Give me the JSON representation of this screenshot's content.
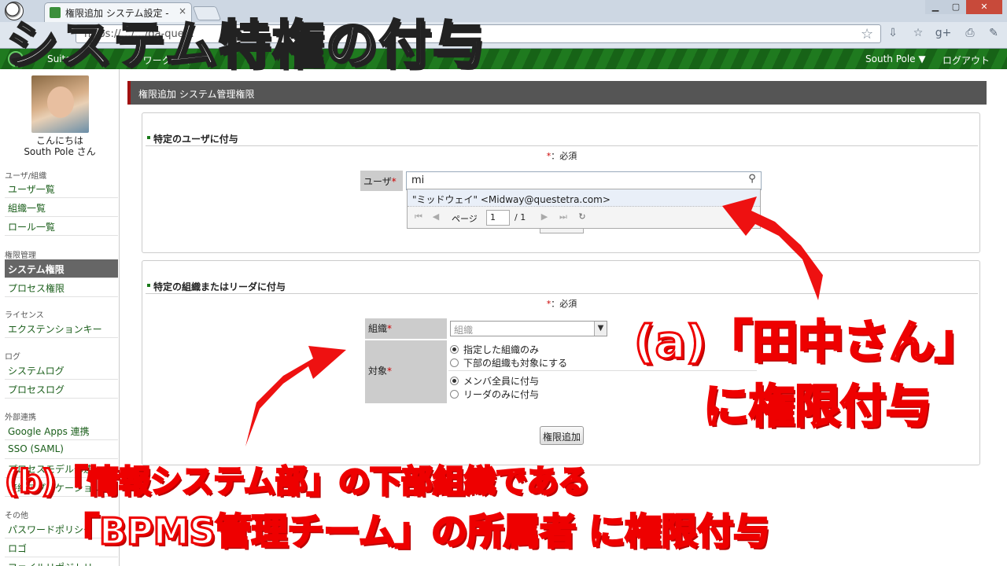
{
  "browser": {
    "tab_title": "権限追加 システム設定 -",
    "tab_close": "×",
    "url": "https://…/…/ga-que…",
    "minimize": "▁",
    "maximize": "▢",
    "close": "✕",
    "star": "☆"
  },
  "appbar": {
    "suite": "Suite",
    "workflow": "W ワークフロー",
    "user_menu": "South Pole ▼",
    "logout": "ログアウト"
  },
  "sidebar": {
    "greeting1": "こんにちは",
    "greeting2": "South Pole さん",
    "sections": {
      "users": "ユーザ/組織",
      "perm": "権限管理",
      "license": "ライセンス",
      "log": "ログ",
      "external": "外部連携",
      "other": "その他"
    },
    "items": {
      "user_list": "ユーザ一覧",
      "org_list": "組織一覧",
      "role_list": "ロール一覧",
      "system_perm": "システム権限",
      "process_perm": "プロセス権限",
      "extension_key": "エクステンションキー",
      "system_log": "システムログ",
      "process_log": "プロセスログ",
      "google_apps": "Google Apps 連携",
      "sso": "SSO (SAML)",
      "process_model": "プロセスモデル部連",
      "connect_app": "接続アプリケーション",
      "password_policy": "パスワードポリシー",
      "logo": "ロゴ",
      "file_repo": "ファイルリポジトリ"
    }
  },
  "main": {
    "title": "権限追加 システム管理権限",
    "section1": {
      "heading": "特定のユーザに付与",
      "required_mark": "*",
      "required_text": "：必須",
      "user_label": "ユーザ",
      "user_value": "mi",
      "suggestion": "\"ミッドウェイ\" <Midway@questetra.com>",
      "pager_label": "ページ",
      "pager_value": "1",
      "pager_total": "/ 1"
    },
    "section2": {
      "heading": "特定の組織またはリーダに付与",
      "required_mark": "*",
      "required_text": "：必須",
      "org_label": "組織",
      "org_placeholder": "組織",
      "target_label": "対象",
      "radio1": "指定した組織のみ",
      "radio2": "下部の組織も対象にする",
      "radio3": "メンバ全員に付与",
      "radio4": "リーダのみに付与",
      "submit": "権限追加"
    }
  },
  "overlay": {
    "title": "システム特権の付与",
    "a_line1": "(a)「田中さん」",
    "a_line2": "に権限付与",
    "b_line1": "(b)「情報システム部」の下部組織である",
    "b_line2": "「BPMS管理チーム」の所属者 に権限付与"
  }
}
